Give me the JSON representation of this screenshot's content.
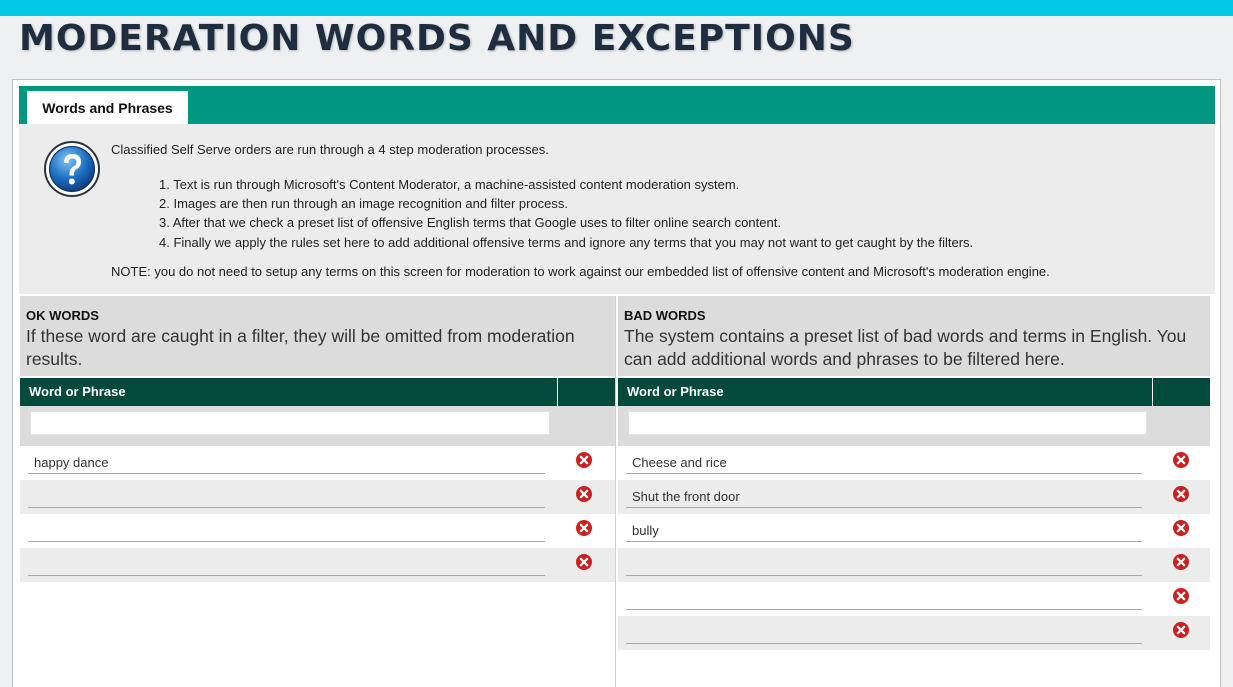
{
  "page": {
    "title": "MODERATION WORDS AND EXCEPTIONS"
  },
  "tabs": [
    {
      "label": "Words and Phrases"
    }
  ],
  "info": {
    "intro": "Classified Self Serve orders are run through a 4 step moderation processes.",
    "steps": [
      "1. Text is run through Microsoft's Content Moderator, a machine-assisted content moderation system.",
      "2. Images are then run through an image recognition and filter process.",
      "3. After that we check a preset list of offensive English terms that Google uses to filter online search content.",
      "4. Finally we apply the rules set here to add additional offensive terms and ignore any terms that you may not want to get caught by the filters."
    ],
    "note": "NOTE: you do not need to setup any terms on this screen for moderation to work against our embedded list of offensive content and Microsoft's moderation engine."
  },
  "ok_words": {
    "heading": "OK WORDS",
    "description": "If these word are caught in a filter, they will be omitted from moderation results.",
    "column_header": "Word or Phrase",
    "filter_value": "",
    "rows": [
      "happy dance",
      "",
      "",
      ""
    ]
  },
  "bad_words": {
    "heading": "BAD WORDS",
    "description": "The system contains a preset list of bad words and terms in English. You can add additional words and phrases to be filtered here.",
    "column_header": "Word or Phrase",
    "filter_value": "",
    "rows": [
      "Cheese and rice",
      "Shut the front door",
      "bully",
      "",
      "",
      ""
    ]
  },
  "colors": {
    "accent_stripe": "#00c9e3",
    "tab_bar": "#009781",
    "grid_header": "#014a3c",
    "delete_icon": "#cc1f1f"
  },
  "icons": {
    "help": "question-mark-icon",
    "delete": "remove-circle-x-icon"
  }
}
